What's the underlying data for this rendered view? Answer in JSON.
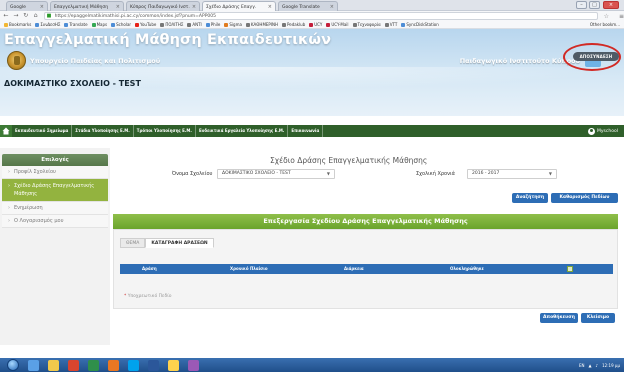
{
  "browser": {
    "tabs": [
      {
        "label": "Google",
        "active": false
      },
      {
        "label": "Επαγγελματική Μάθηση",
        "active": false
      },
      {
        "label": "Κύπρος Παιδαγωγικό Ινστ.",
        "active": false
      },
      {
        "label": "Σχέδιο Δράσης Επαγγ.",
        "active": true
      },
      {
        "label": "Google Translate",
        "active": false
      }
    ],
    "url": "https://epaggelmatikimathisi.pi.ac.cy/common/index.jsf?pnum=APP005",
    "bookmarks": [
      {
        "label": "Bookmarks",
        "color": "#f2b632"
      },
      {
        "label": "ΣυνΔεσΗΣ",
        "color": "#4d8dd6"
      },
      {
        "label": "Translate",
        "color": "#4d8dd6"
      },
      {
        "label": "Maps",
        "color": "#34a853"
      },
      {
        "label": "Scholar",
        "color": "#4d8dd6"
      },
      {
        "label": "YouTube",
        "color": "#e62117"
      },
      {
        "label": "ΠΟΛΙΤΗΣ",
        "color": "#777"
      },
      {
        "label": "ΑΝΤΙ",
        "color": "#777"
      },
      {
        "label": "Phile",
        "color": "#4d8dd6"
      },
      {
        "label": "Sigma",
        "color": "#e07b1e"
      },
      {
        "label": "ΚΑΘΗΜΕΡΙΝΗ",
        "color": "#777"
      },
      {
        "label": "Pedaklub",
        "color": "#777"
      },
      {
        "label": "UCY",
        "color": "#c41e3a"
      },
      {
        "label": "UCY-Mail",
        "color": "#c41e3a"
      },
      {
        "label": "Τεχνοφορία",
        "color": "#777"
      },
      {
        "label": "VTT",
        "color": "#777"
      },
      {
        "label": "SyncDiskStation",
        "color": "#4d8dd6"
      }
    ],
    "other_bookmarks": "Other bookm..."
  },
  "header": {
    "site_title": "Επαγγελματική Μάθηση Εκπαιδευτικών",
    "ministry": "Υπουργείο Παιδείας και Πολιτισμού",
    "institute": "Παιδαγωγικό Ινστιτούτο Κύπρου",
    "logout": "ΑΠΟΣΥΝΔΕΣΗ",
    "school_name": "ΔΟΚΙΜΑΣΤΙΚΟ ΣΧΟΛΕΙΟ - TEST"
  },
  "nav": {
    "items": [
      "Εκπαιδευτικό Σημείωμα",
      "Στάδια Υλοποίησης Ε.Μ.",
      "Τρόποι Υλοποίησης Ε.Μ.",
      "Ενδεικτικά Εργαλεία Υλοποίησης Ε.Μ.",
      "Επικοινωνία"
    ],
    "user": "Myschool"
  },
  "sidebar": {
    "header": "Επιλογές",
    "items": [
      {
        "label": "Προφίλ Σχολείου",
        "active": false
      },
      {
        "label": "Σχέδιο Δράσης Επαγγελματικής Μάθησης",
        "active": true
      },
      {
        "label": "Ενημέρωση",
        "active": false
      },
      {
        "label": "Ο Λογαριασμός μου",
        "active": false
      }
    ]
  },
  "main": {
    "title": "Σχέδιο Δράσης Επαγγελματικής Μάθησης",
    "school_label": "Όνομα Σχολείου",
    "school_value": "ΔΟΚΙΜΑΣΤΙΚΟ ΣΧΟΛΕΙΟ - TEST",
    "year_label": "Σχολική Χρονιά",
    "year_value": "2016 - 2017",
    "search_button": "Αναζήτηση",
    "clear_button": "Καθαρισμός Πεδίων",
    "panel_title": "Επεξεργασία Σχεδίου Δράσης Επαγγελματικής Μάθησης",
    "tabs": [
      "ΘΕΜΑ",
      "ΚΑΤΑΓΡΑΦΗ ΔΡΑΣΕΩΝ"
    ],
    "active_tab": 1,
    "table_headers": [
      "Δράση",
      "Χρονικό Πλαίσιο",
      "Διάρκεια",
      "Ολοκληρώθηκε"
    ],
    "required_note": "Υποχρεωτικό Πεδίο",
    "save_button": "Αποθήκευση",
    "close_button": "Κλείσιμο"
  },
  "taskbar": {
    "lang": "EN",
    "time": "12:19 μμ"
  }
}
